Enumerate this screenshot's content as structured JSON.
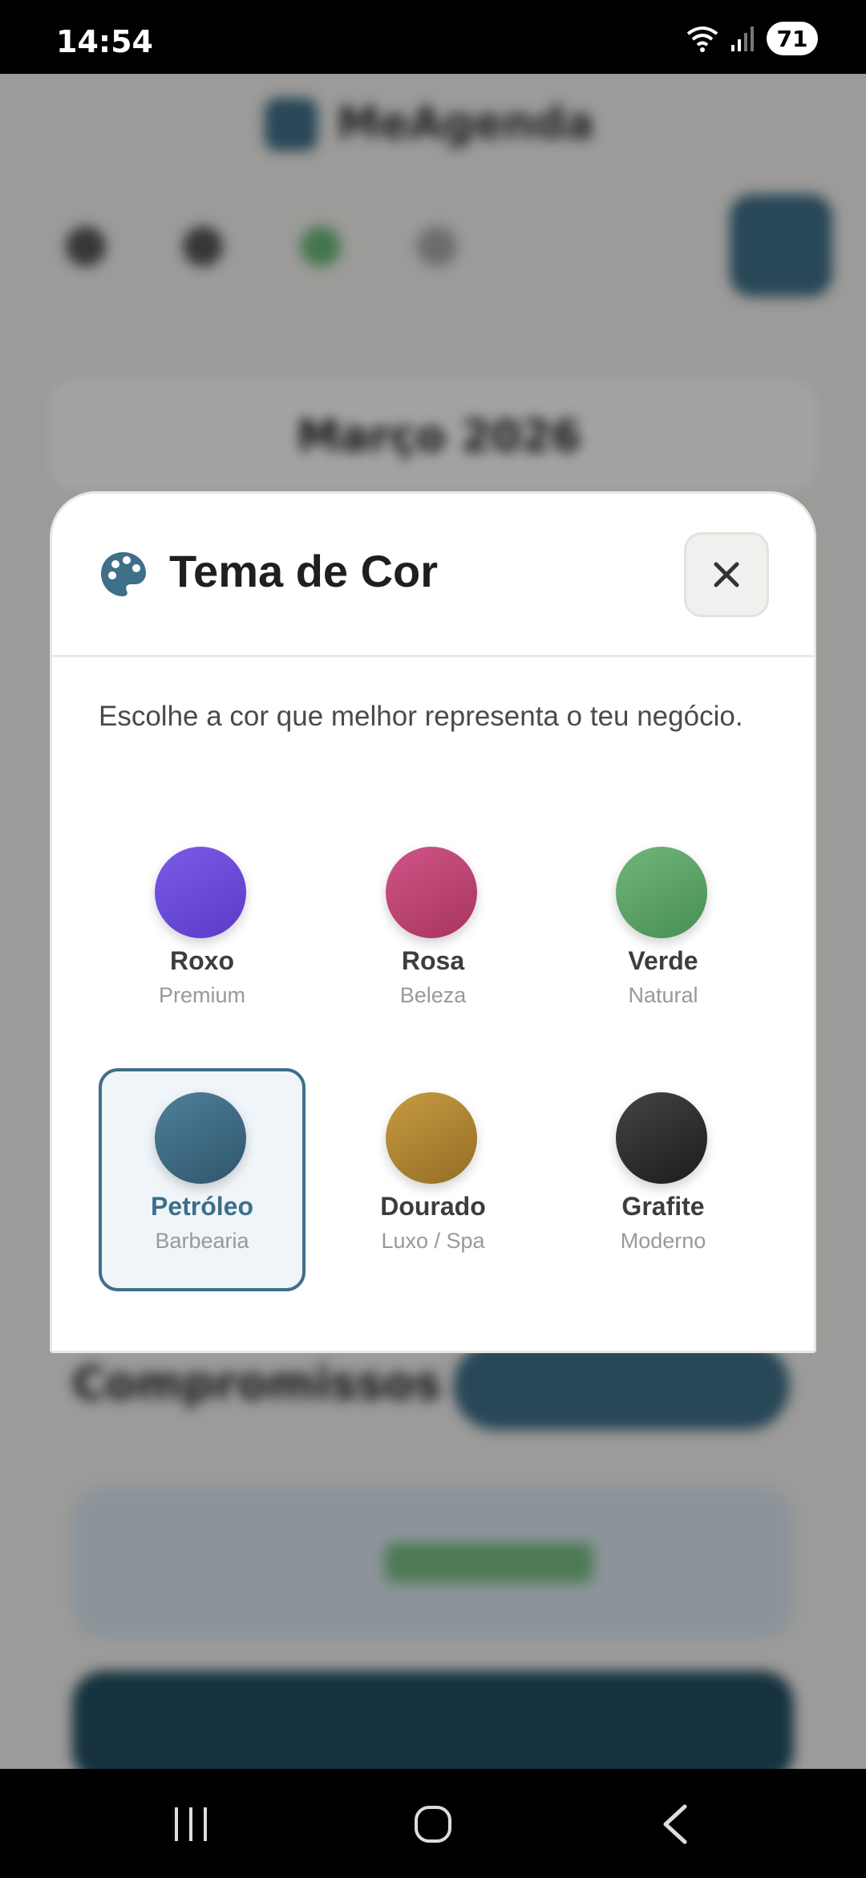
{
  "status_bar": {
    "time": "14:54",
    "battery": "71"
  },
  "background": {
    "app_name": "MeAgenda",
    "month": "Março 2026",
    "section_title": "Compromissos"
  },
  "modal": {
    "title": "Tema de Cor",
    "close_icon": "close-icon",
    "description": "Escolhe a cor que melhor representa o teu negócio.",
    "themes": [
      {
        "name": "Roxo",
        "subtitle": "Premium",
        "color_from": "#7b5be6",
        "color_to": "#5a3bc8",
        "selected": false
      },
      {
        "name": "Rosa",
        "subtitle": "Beleza",
        "color_from": "#cf5586",
        "color_to": "#a8345f",
        "selected": false
      },
      {
        "name": "Verde",
        "subtitle": "Natural",
        "color_from": "#72b57a",
        "color_to": "#478f52",
        "selected": false
      },
      {
        "name": "Petróleo",
        "subtitle": "Barbearia",
        "color_from": "#4e7f9a",
        "color_to": "#2f566c",
        "selected": true
      },
      {
        "name": "Dourado",
        "subtitle": "Luxo / Spa",
        "color_from": "#c79b40",
        "color_to": "#936d26",
        "selected": false
      },
      {
        "name": "Grafite",
        "subtitle": "Moderno",
        "color_from": "#444444",
        "color_to": "#1c1c1c",
        "selected": false
      }
    ]
  },
  "accent_color": "#3f6f89"
}
